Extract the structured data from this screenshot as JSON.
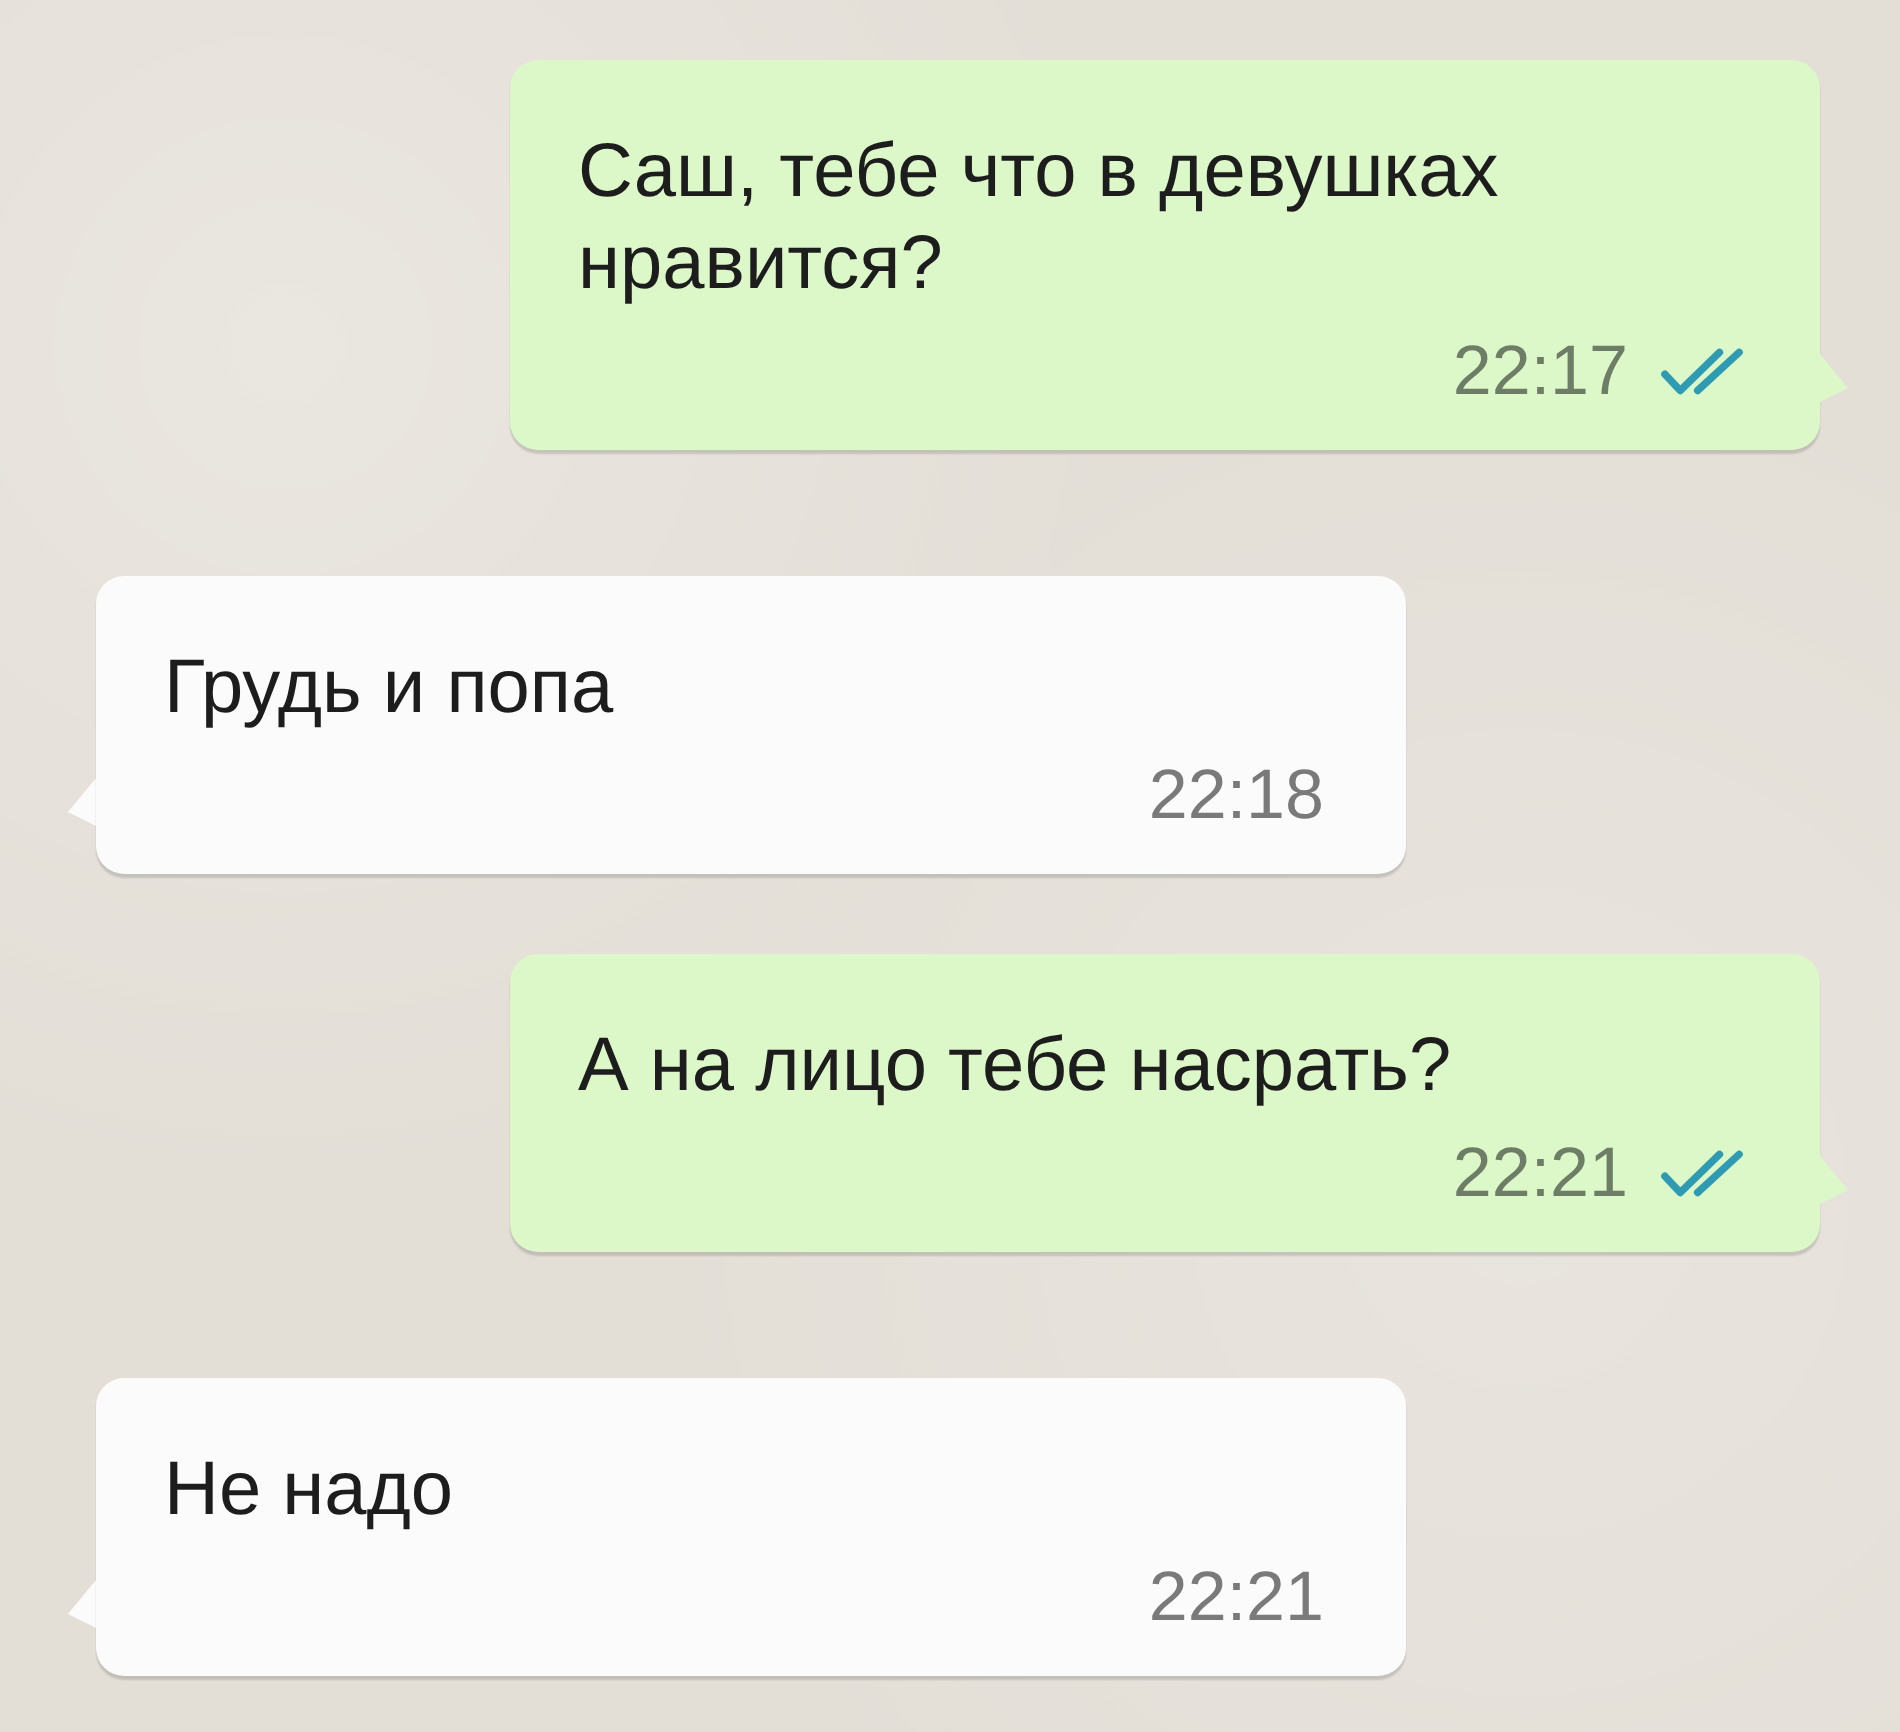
{
  "messages": [
    {
      "kind": "outgoing",
      "text": "Саш, тебе что в девушках\nнравится?",
      "time": "22:17",
      "read": true
    },
    {
      "kind": "incoming",
      "text": "Грудь и попа",
      "time": "22:18"
    },
    {
      "kind": "outgoing",
      "text": "А на лицо тебе насрать?",
      "time": "22:21",
      "read": true
    },
    {
      "kind": "incoming",
      "text": "Не надо",
      "time": "22:21"
    }
  ]
}
